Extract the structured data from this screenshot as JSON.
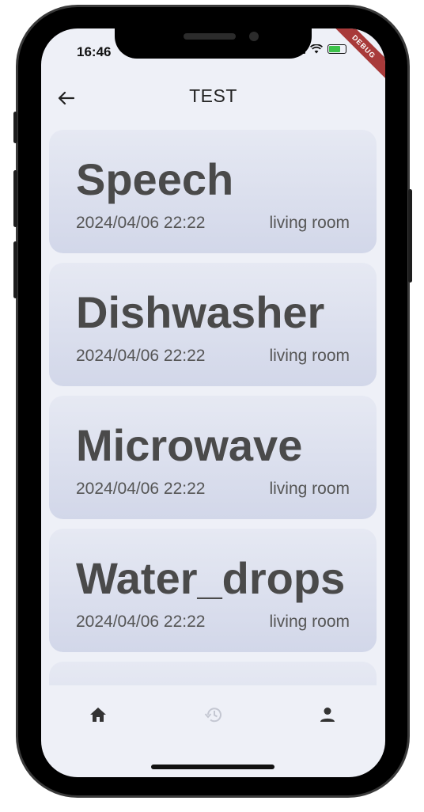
{
  "status_bar": {
    "time": "16:46",
    "debug_label": "DEBUG"
  },
  "appbar": {
    "title": "TEST",
    "back_icon": "arrow-left-icon"
  },
  "items": [
    {
      "name": "Speech",
      "date": "2024/04/06 22:22",
      "room": "living room"
    },
    {
      "name": "Dishwasher",
      "date": "2024/04/06 22:22",
      "room": "living room"
    },
    {
      "name": "Microwave",
      "date": "2024/04/06 22:22",
      "room": "living room"
    },
    {
      "name": "Water_drops",
      "date": "2024/04/06 22:22",
      "room": "living room"
    }
  ],
  "bottom_nav": {
    "items": [
      {
        "icon": "home-icon",
        "active": true
      },
      {
        "icon": "history-icon",
        "active": false
      },
      {
        "icon": "person-icon",
        "active": true
      }
    ]
  },
  "colors": {
    "card_top": "#e6e9f3",
    "card_bottom": "#d2d7e9",
    "debug_banner": "#a83a3a",
    "background": "#eef0f7"
  }
}
